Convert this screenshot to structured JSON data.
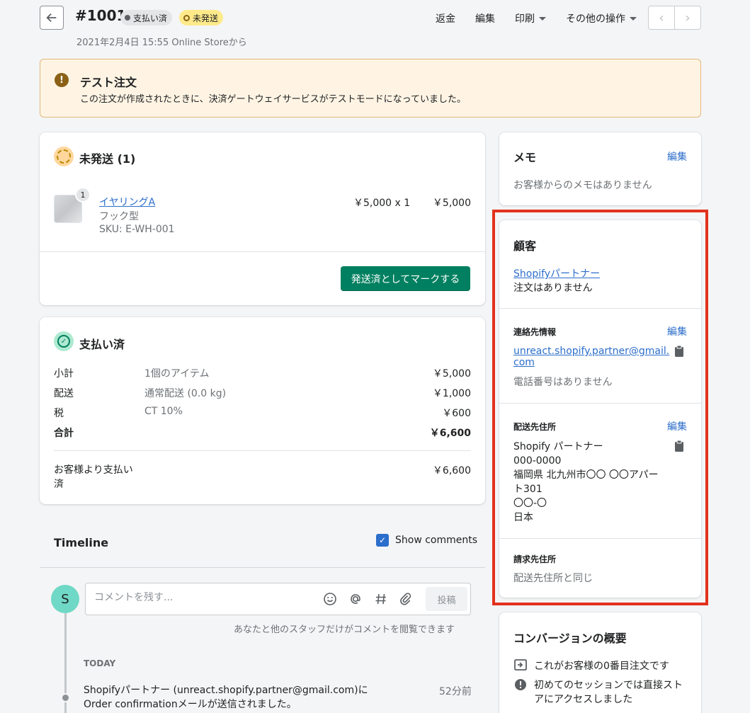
{
  "header": {
    "order_number": "#1001",
    "badge_paid": "支払い済",
    "badge_unfulfilled": "未発送",
    "subtitle": "2021年2月4日 15:55 Online Storeから",
    "actions": {
      "refund": "返金",
      "edit": "編集",
      "print": "印刷",
      "more": "その他の操作"
    },
    "pager": {
      "prev": "‹",
      "next": "›"
    }
  },
  "banner": {
    "title": "テスト注文",
    "text": "この注文が作成されたときに、決済ゲートウェイサービスがテストモードになっていました。"
  },
  "fulfillment": {
    "title": "未発送 (1)",
    "item": {
      "quantity_badge": "1",
      "name": "イヤリングA",
      "variant": "フック型",
      "sku": "SKU: E-WH-001",
      "unit_price": "￥5,000 x 1",
      "total": "￥5,000"
    },
    "button": "発送済としてマークする"
  },
  "payment": {
    "title": "支払い済",
    "rows": [
      {
        "label": "小計",
        "detail": "1個のアイテム",
        "amount": "￥5,000"
      },
      {
        "label": "配送",
        "detail": "通常配送 (0.0 kg)",
        "amount": "￥1,000"
      },
      {
        "label": "税",
        "detail": "CT 10%",
        "amount": "￥600"
      },
      {
        "label": "合計",
        "detail": "",
        "amount": "￥6,600"
      }
    ],
    "paid_by_customer_label": "お客様より支払い済",
    "paid_by_customer_amount": "￥6,600"
  },
  "timeline": {
    "title": "Timeline",
    "show_comments": "Show comments",
    "avatar_initial": "S",
    "comment_placeholder": "コメントを残す...",
    "post_button": "投稿",
    "staff_note": "あなたと他のスタッフだけがコメントを閲覧できます",
    "day_label": "TODAY",
    "event_text": "Shopifyパートナー (unreact.shopify.partner@gmail.com)にOrder confirmationメールが送信されました。",
    "event_time": "52分前"
  },
  "memo": {
    "title": "メモ",
    "edit": "編集",
    "empty": "お客様からのメモはありません"
  },
  "customer": {
    "title": "顧客",
    "name": "Shopifyパートナー",
    "orders": "注文はありません",
    "contact": {
      "title": "連絡先情報",
      "edit": "編集",
      "email_line1": "unreact.shopify.partner@gmail.",
      "email_line2": "com",
      "phone": "電話番号はありません"
    },
    "shipping": {
      "title": "配送先住所",
      "edit": "編集",
      "lines": [
        "Shopify パートナー",
        "000-0000",
        "福岡県 北九州市〇〇 〇〇アパー",
        "ト301",
        "〇〇-〇",
        "日本"
      ]
    },
    "billing": {
      "title": "請求先住所",
      "same": "配送先住所と同じ"
    }
  },
  "conversion": {
    "title": "コンバージョンの概要",
    "line1": "これがお客様の0番目注文です",
    "line2a": "初めてのセッションでは直接スト",
    "line2b": "アにアクセスしました"
  },
  "colors": {
    "primary": "#008060",
    "link": "#2c6ecb",
    "highlight": "#e2321d",
    "banner_bg": "#fff4e4"
  }
}
